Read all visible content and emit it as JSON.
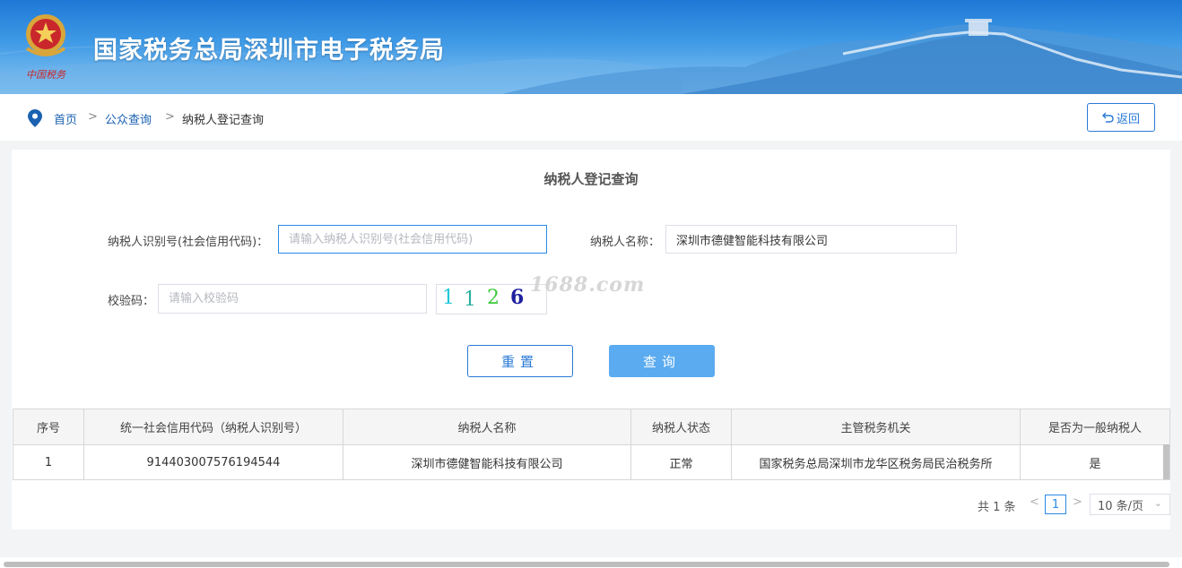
{
  "header": {
    "emblem_text": "中国税务",
    "site_title": "国家税务总局深圳市电子税务局"
  },
  "breadcrumb": {
    "home": "首页",
    "public_query": "公众查询",
    "current": "纳税人登记查询",
    "separator": ">"
  },
  "back_button": {
    "icon": "return-arrow-icon",
    "label": "返回"
  },
  "form": {
    "title": "纳税人登记查询",
    "taxpayer_id_label": "纳税人识别号(社会信用代码)：",
    "taxpayer_id_value": "",
    "taxpayer_id_placeholder": "请输入纳税人识别号(社会信用代码)",
    "taxpayer_name_label": "纳税人名称：",
    "taxpayer_name_value": "深圳市德健智能科技有限公司",
    "captcha_label": "校验码：",
    "captcha_value": "",
    "captcha_placeholder": "请输入校验码",
    "captcha_chars": [
      "1",
      "1",
      "2",
      "6"
    ],
    "captcha_colors": [
      "#20c8d8",
      "#2ab0a0",
      "#3cc83c",
      "#2020a0"
    ],
    "watermark": "1688.com",
    "reset_label": "重置",
    "search_label": "查询"
  },
  "table": {
    "columns": [
      "序号",
      "统一社会信用代码（纳税人识别号）",
      "纳税人名称",
      "纳税人状态",
      "主管税务机关",
      "是否为一般纳税人"
    ],
    "rows": [
      [
        "1",
        "914403007576194544",
        "深圳市德健智能科技有限公司",
        "正常",
        "国家税务总局深圳市龙华区税务局民治税务所",
        "是"
      ]
    ]
  },
  "pagination": {
    "total": "共 1 条",
    "prev": "<",
    "next": ">",
    "current_page": "1",
    "page_size": "10 条/页"
  },
  "colors": {
    "brand_blue": "#2a7ad6",
    "search_button": "#5aabf0",
    "banner_top": "#1f78d6"
  }
}
